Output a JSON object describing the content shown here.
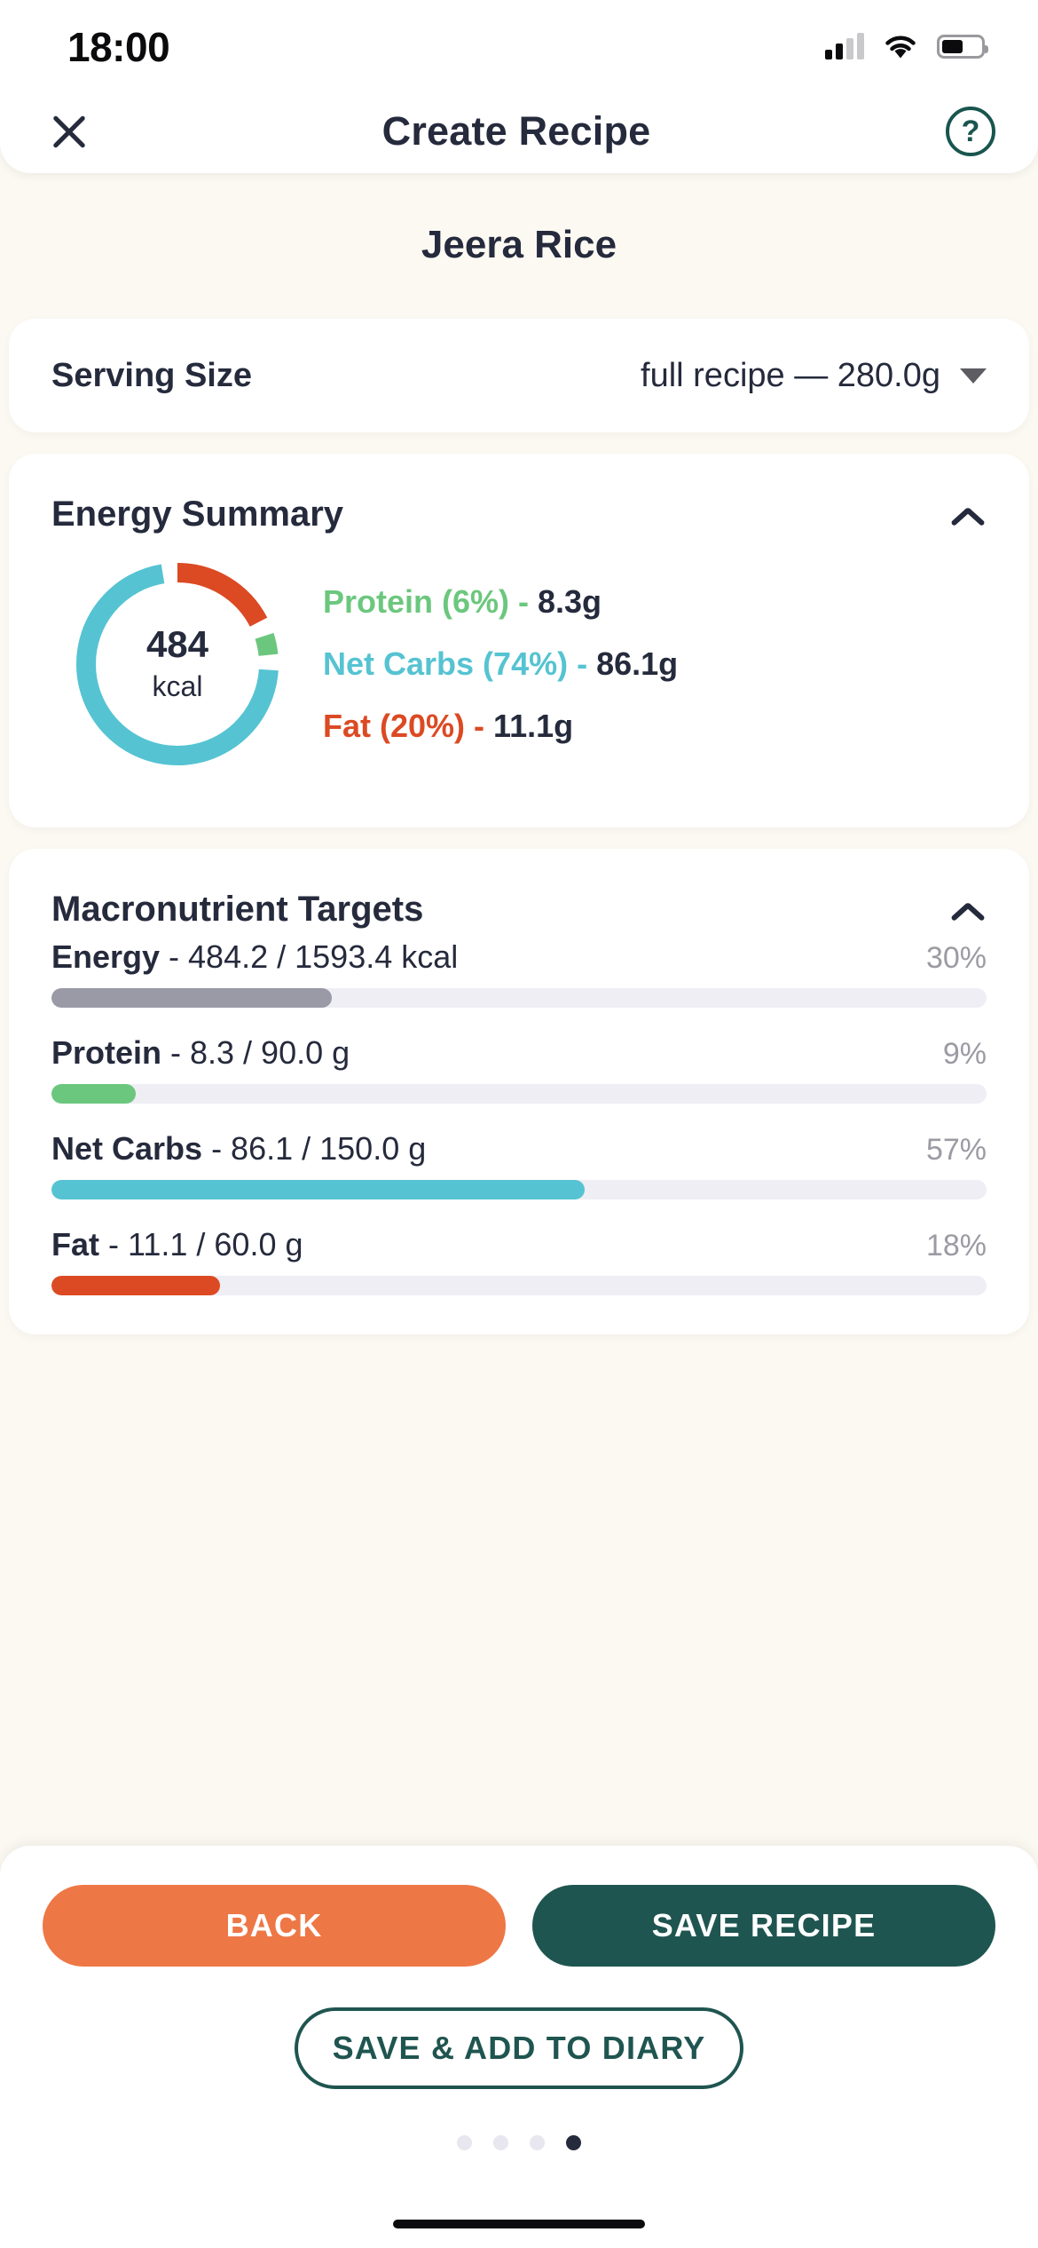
{
  "status_bar": {
    "time": "18:00",
    "signal_icon": "cellular-signal-icon",
    "wifi_icon": "wifi-icon",
    "battery_icon": "battery-icon"
  },
  "header": {
    "close_icon": "close-icon",
    "title": "Create Recipe",
    "help_icon": "help-circle-icon",
    "help_label": "?"
  },
  "recipe": {
    "name": "Jeera Rice"
  },
  "serving_size": {
    "label": "Serving Size",
    "value": "full recipe — 280.0g",
    "dropdown_icon": "chevron-down-icon"
  },
  "energy_summary": {
    "title": "Energy Summary",
    "collapse_icon": "chevron-up-icon",
    "kcal_value": "484",
    "kcal_unit": "kcal",
    "legend": [
      {
        "name": "Protein",
        "percent": "6%",
        "label": "Protein (6%) -",
        "value": "8.3g",
        "color": "#6CC77E"
      },
      {
        "name": "Net Carbs",
        "percent": "74%",
        "label": "Net Carbs (74%) -",
        "value": "86.1g",
        "color": "#55C3D2"
      },
      {
        "name": "Fat",
        "percent": "20%",
        "label": "Fat (20%) -",
        "value": "11.1g",
        "color": "#DB4A23"
      }
    ]
  },
  "chart_data": {
    "type": "pie",
    "title": "Energy Summary",
    "center_label": "484 kcal",
    "categories": [
      "Fat",
      "Protein",
      "Net Carbs"
    ],
    "values": [
      20,
      6,
      74
    ],
    "grams": [
      "11.1g",
      "8.3g",
      "86.1g"
    ],
    "colors": [
      "#DB4A23",
      "#6CC77E",
      "#55C3D2"
    ],
    "unit": "%",
    "legend_position": "right",
    "start_angle_deg": 0,
    "donut": true
  },
  "macro_targets": {
    "title": "Macronutrient Targets",
    "collapse_icon": "chevron-up-icon",
    "items": [
      {
        "name": "Energy",
        "detail": "- 484.2 / 1593.4 kcal",
        "percent_label": "30%",
        "fill_percent": 30,
        "color": "#9A9AA6"
      },
      {
        "name": "Protein",
        "detail": "- 8.3 / 90.0 g",
        "percent_label": "9%",
        "fill_percent": 9,
        "color": "#6CC77E"
      },
      {
        "name": "Net Carbs",
        "detail": "- 86.1 / 150.0 g",
        "percent_label": "57%",
        "fill_percent": 57,
        "color": "#55C3D2"
      },
      {
        "name": "Fat",
        "detail": "- 11.1 / 60.0 g",
        "percent_label": "18%",
        "fill_percent": 18,
        "color": "#DB4A23"
      }
    ]
  },
  "footer": {
    "back_label": "BACK",
    "save_label": "SAVE RECIPE",
    "diary_label": "SAVE & ADD TO DIARY",
    "pagination": {
      "total": 4,
      "active_index": 3
    }
  },
  "theme": {
    "background": "#FBF9F2",
    "card": "#FFFFFF",
    "text": "#252A3C",
    "teal": "#1F5550",
    "orange": "#EE7746",
    "track": "#EEEEF4"
  }
}
